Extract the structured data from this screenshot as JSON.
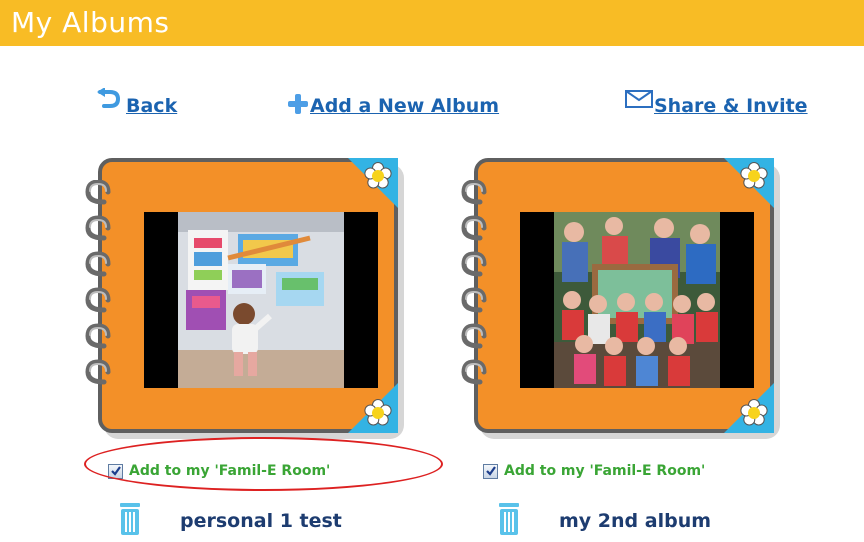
{
  "header": {
    "title": "My Albums"
  },
  "nav": {
    "back_label": "Back",
    "add_album_label": "Add a New Album",
    "share_label": "Share & Invite"
  },
  "albums": [
    {
      "name": "personal 1 test",
      "add_to_room_label": "Add to my 'Famil-E Room'",
      "add_to_room_checked": true
    },
    {
      "name": "my 2nd album",
      "add_to_room_label": "Add to my 'Famil-E Room'",
      "add_to_room_checked": true
    }
  ],
  "colors": {
    "header_bg": "#f8bc25",
    "link": "#1b63b0",
    "album_cover": "#f39028",
    "add_room_text": "#3aa535",
    "album_title": "#1d3c70",
    "highlight": "#dd2121"
  },
  "icons": {
    "back": "back-arrow-icon",
    "add": "plus-icon",
    "share": "envelope-icon",
    "delete": "trash-icon",
    "album_corner": "flower-icon"
  }
}
